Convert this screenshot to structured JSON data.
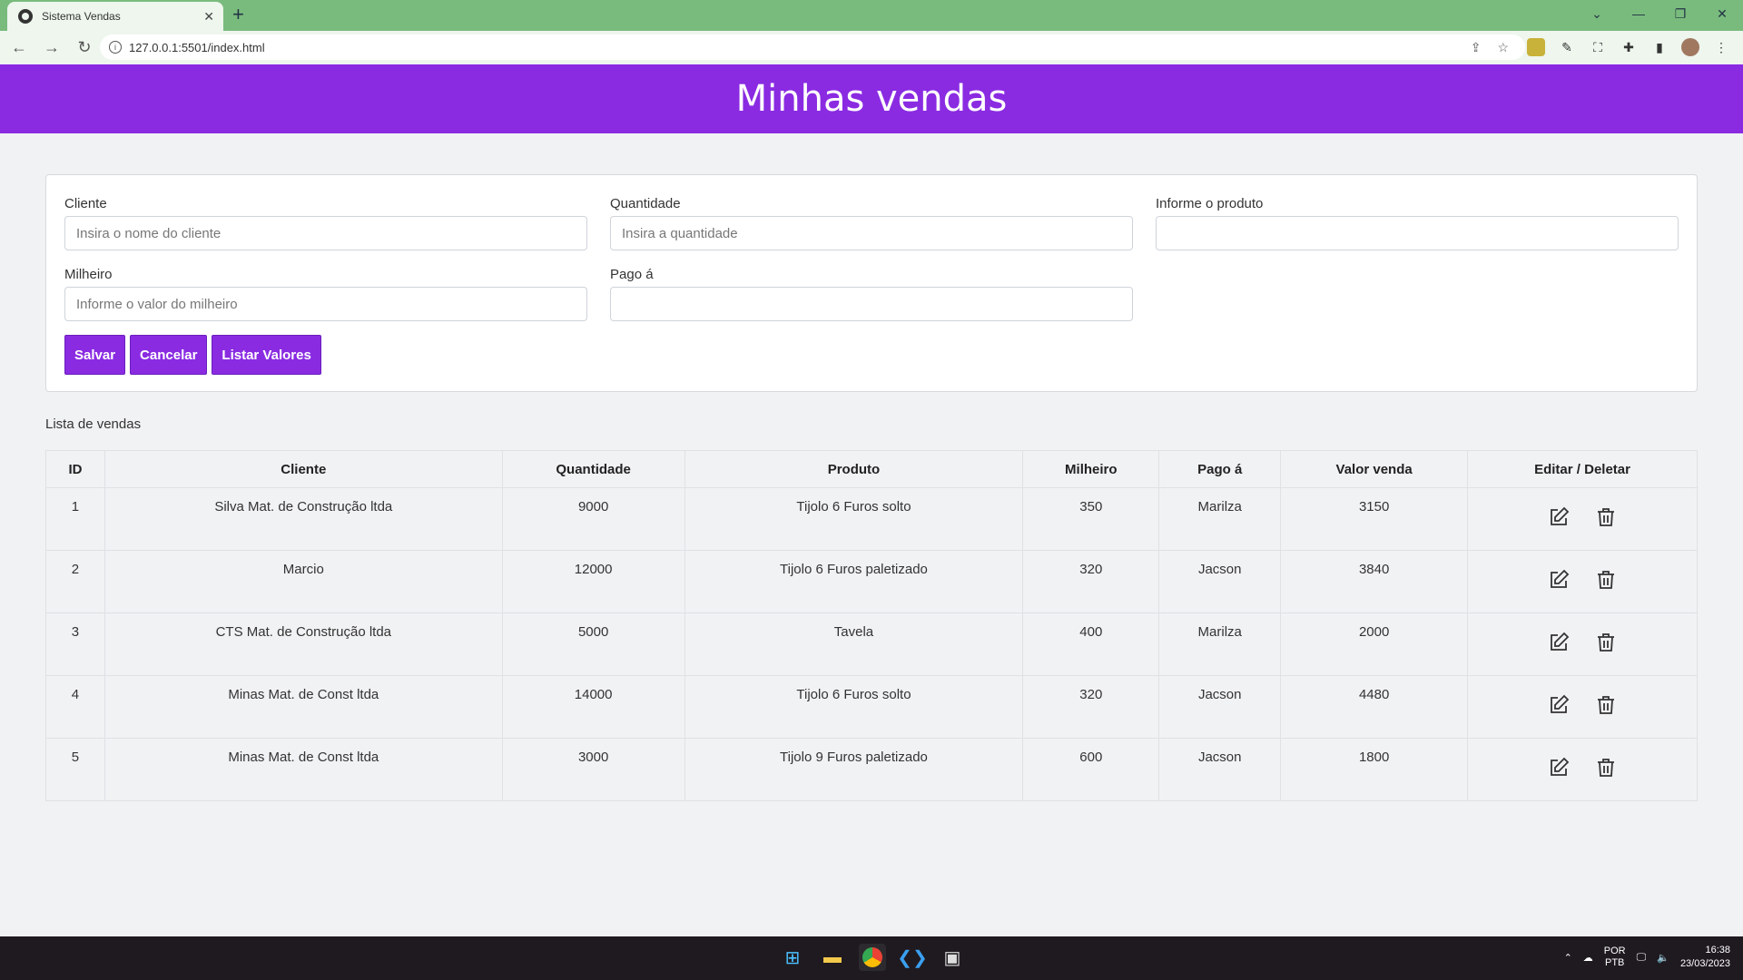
{
  "browser": {
    "tab_title": "Sistema Vendas",
    "tab_close": "✕",
    "new_tab": "+",
    "url": "127.0.0.1:5501/index.html"
  },
  "page": {
    "title": "Minhas vendas"
  },
  "form": {
    "cliente_label": "Cliente",
    "cliente_placeholder": "Insira o nome do cliente",
    "quantidade_label": "Quantidade",
    "quantidade_placeholder": "Insira a quantidade",
    "produto_label": "Informe o produto",
    "produto_placeholder": "",
    "milheiro_label": "Milheiro",
    "milheiro_placeholder": "Informe o valor do milheiro",
    "pago_label": "Pago á",
    "pago_placeholder": "",
    "save_label": "Salvar",
    "cancel_label": "Cancelar",
    "list_label": "Listar Valores"
  },
  "list": {
    "title": "Lista de vendas",
    "headers": [
      "ID",
      "Cliente",
      "Quantidade",
      "Produto",
      "Milheiro",
      "Pago á",
      "Valor venda",
      "Editar / Deletar"
    ],
    "rows": [
      {
        "id": "1",
        "cliente": "Silva Mat. de Construção ltda",
        "quantidade": "9000",
        "produto": "Tijolo 6 Furos solto",
        "milheiro": "350",
        "pago": "Marilza",
        "valor": "3150"
      },
      {
        "id": "2",
        "cliente": "Marcio",
        "quantidade": "12000",
        "produto": "Tijolo 6 Furos paletizado",
        "milheiro": "320",
        "pago": "Jacson",
        "valor": "3840"
      },
      {
        "id": "3",
        "cliente": "CTS Mat. de Construção ltda",
        "quantidade": "5000",
        "produto": "Tavela",
        "milheiro": "400",
        "pago": "Marilza",
        "valor": "2000"
      },
      {
        "id": "4",
        "cliente": "Minas Mat. de Const ltda",
        "quantidade": "14000",
        "produto": "Tijolo 6 Furos solto",
        "milheiro": "320",
        "pago": "Jacson",
        "valor": "4480"
      },
      {
        "id": "5",
        "cliente": "Minas Mat. de Const ltda",
        "quantidade": "3000",
        "produto": "Tijolo 9 Furos paletizado",
        "milheiro": "600",
        "pago": "Jacson",
        "valor": "1800"
      }
    ]
  },
  "taskbar": {
    "lang_line1": "POR",
    "lang_line2": "PTB",
    "time": "16:38",
    "date": "23/03/2023"
  },
  "colors": {
    "accent": "#8a2be2",
    "tab_bar": "#79bb7d"
  }
}
